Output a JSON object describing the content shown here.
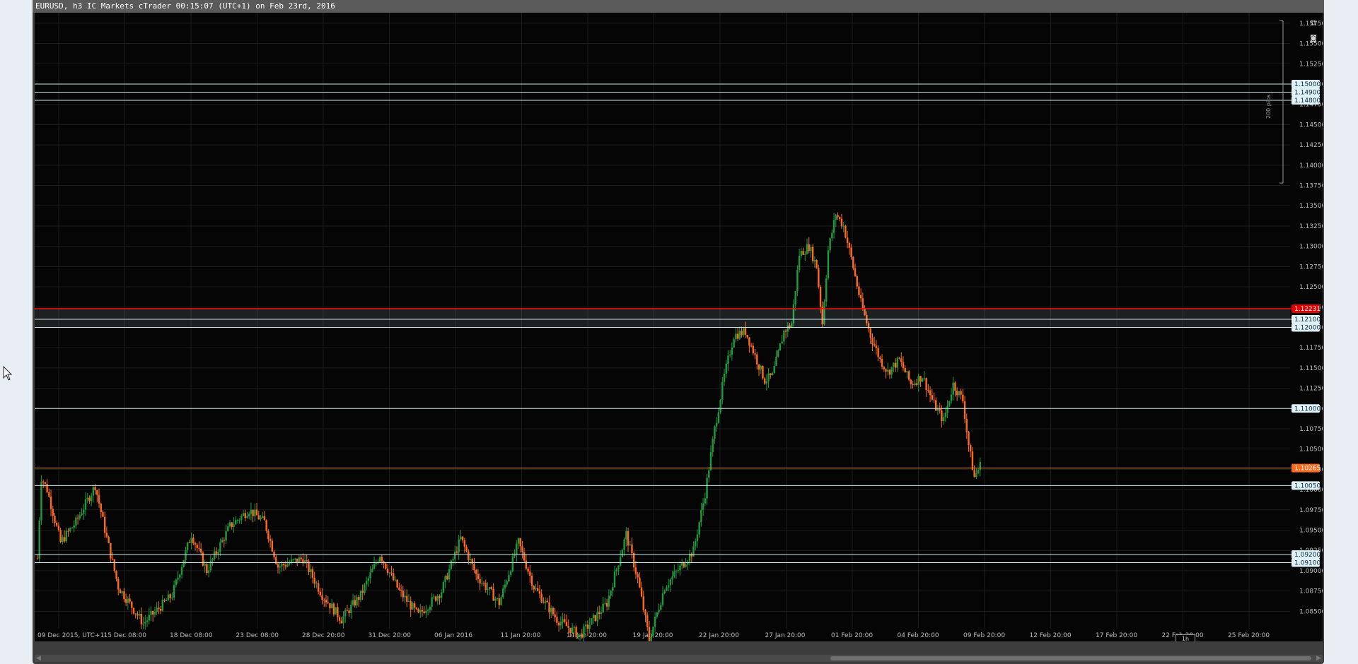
{
  "window": {
    "title": "EURUSD, h3 IC Markets cTrader 00:15:07 (UTC+1) on Feb 23rd, 2016"
  },
  "chart": {
    "symbol": "EURUSD",
    "timeframe_badge": "1h",
    "pips_label": "200 pips",
    "colors": {
      "background": "#050505",
      "grid": "#1c1c1c",
      "bull": "#1f9a3e",
      "bear": "#ff6a1f",
      "level_line": "#cfe6ee",
      "red_line": "#ff0000",
      "current_line": "#d38a1a"
    },
    "icons": {
      "detach": "detach-icon",
      "screenshot": "camera-icon"
    }
  },
  "axis": {
    "price_ticks": [
      "1.15750",
      "1.15500",
      "1.15250",
      "1.15000",
      "1.14750",
      "1.14500",
      "1.14250",
      "1.14000",
      "1.13750",
      "1.13500",
      "1.13250",
      "1.13000",
      "1.12750",
      "1.12500",
      "1.12250",
      "1.12000",
      "1.11750",
      "1.11500",
      "1.11250",
      "1.11000",
      "1.10750",
      "1.10500",
      "1.10250",
      "1.10000",
      "1.09750",
      "1.09500",
      "1.09250",
      "1.09000",
      "1.08750",
      "1.08500"
    ],
    "time_ticks": [
      "09 Dec 2015, UTC+1",
      "15 Dec 08:00",
      "18 Dec 08:00",
      "23 Dec 08:00",
      "28 Dec 20:00",
      "31 Dec 20:00",
      "06 Jan 2016",
      "11 Jan 20:00",
      "14 Jan 20:00",
      "19 Jan 20:00",
      "22 Jan 20:00",
      "27 Jan 20:00",
      "01 Feb 20:00",
      "04 Feb 20:00",
      "09 Feb 20:00",
      "12 Feb 20:00",
      "17 Feb 20:00",
      "22 Feb 20:00",
      "25 Feb 20:00"
    ]
  },
  "horizontal_lines": [
    {
      "label": "1.15000",
      "type": "level"
    },
    {
      "label": "1.14900",
      "type": "level"
    },
    {
      "label": "1.14800",
      "type": "level"
    },
    {
      "label": "1.12231",
      "type": "red"
    },
    {
      "label": "1.12100",
      "type": "level"
    },
    {
      "label": "1.12000",
      "type": "level"
    },
    {
      "label": "1.11000",
      "type": "level"
    },
    {
      "label": "1.10265",
      "type": "current"
    },
    {
      "label": "1.10050",
      "type": "level"
    },
    {
      "label": "1.09200",
      "type": "level"
    },
    {
      "label": "1.09100",
      "type": "level"
    }
  ],
  "price_waypoints": [
    [
      0,
      1.0915
    ],
    [
      2,
      1.1015
    ],
    [
      5,
      1.1
    ],
    [
      12,
      1.0935
    ],
    [
      20,
      1.096
    ],
    [
      30,
      1.1005
    ],
    [
      36,
      1.094
    ],
    [
      42,
      1.088
    ],
    [
      55,
      1.0835
    ],
    [
      70,
      1.087
    ],
    [
      80,
      1.0945
    ],
    [
      88,
      1.09
    ],
    [
      100,
      1.0955
    ],
    [
      110,
      1.0975
    ],
    [
      118,
      1.096
    ],
    [
      125,
      1.0905
    ],
    [
      138,
      1.0915
    ],
    [
      148,
      1.087
    ],
    [
      158,
      1.084
    ],
    [
      168,
      1.087
    ],
    [
      178,
      1.092
    ],
    [
      188,
      1.0875
    ],
    [
      198,
      1.0845
    ],
    [
      210,
      1.0875
    ],
    [
      220,
      1.094
    ],
    [
      228,
      1.0895
    ],
    [
      240,
      1.086
    ],
    [
      250,
      1.0935
    ],
    [
      258,
      1.088
    ],
    [
      270,
      1.084
    ],
    [
      282,
      1.082
    ],
    [
      296,
      1.086
    ],
    [
      306,
      1.0945
    ],
    [
      312,
      1.089
    ],
    [
      318,
      1.0815
    ],
    [
      326,
      1.088
    ],
    [
      336,
      1.091
    ],
    [
      341,
      1.0925
    ],
    [
      347,
      1.0995
    ],
    [
      352,
      1.1075
    ],
    [
      357,
      1.114
    ],
    [
      362,
      1.119
    ],
    [
      368,
      1.1195
    ],
    [
      373,
      1.1165
    ],
    [
      378,
      1.1135
    ],
    [
      382,
      1.114
    ],
    [
      388,
      1.1195
    ],
    [
      392,
      1.1205
    ],
    [
      396,
      1.129
    ],
    [
      401,
      1.13
    ],
    [
      405,
      1.1275
    ],
    [
      408,
      1.1205
    ],
    [
      411,
      1.1295
    ],
    [
      415,
      1.134
    ],
    [
      419,
      1.1325
    ],
    [
      423,
      1.1285
    ],
    [
      428,
      1.123
    ],
    [
      433,
      1.119
    ],
    [
      438,
      1.116
    ],
    [
      442,
      1.1145
    ],
    [
      448,
      1.116
    ],
    [
      454,
      1.113
    ],
    [
      460,
      1.114
    ],
    [
      466,
      1.1105
    ],
    [
      471,
      1.1085
    ],
    [
      476,
      1.113
    ],
    [
      481,
      1.111
    ],
    [
      484,
      1.1055
    ],
    [
      487,
      1.1015
    ],
    [
      490,
      1.103
    ]
  ]
}
